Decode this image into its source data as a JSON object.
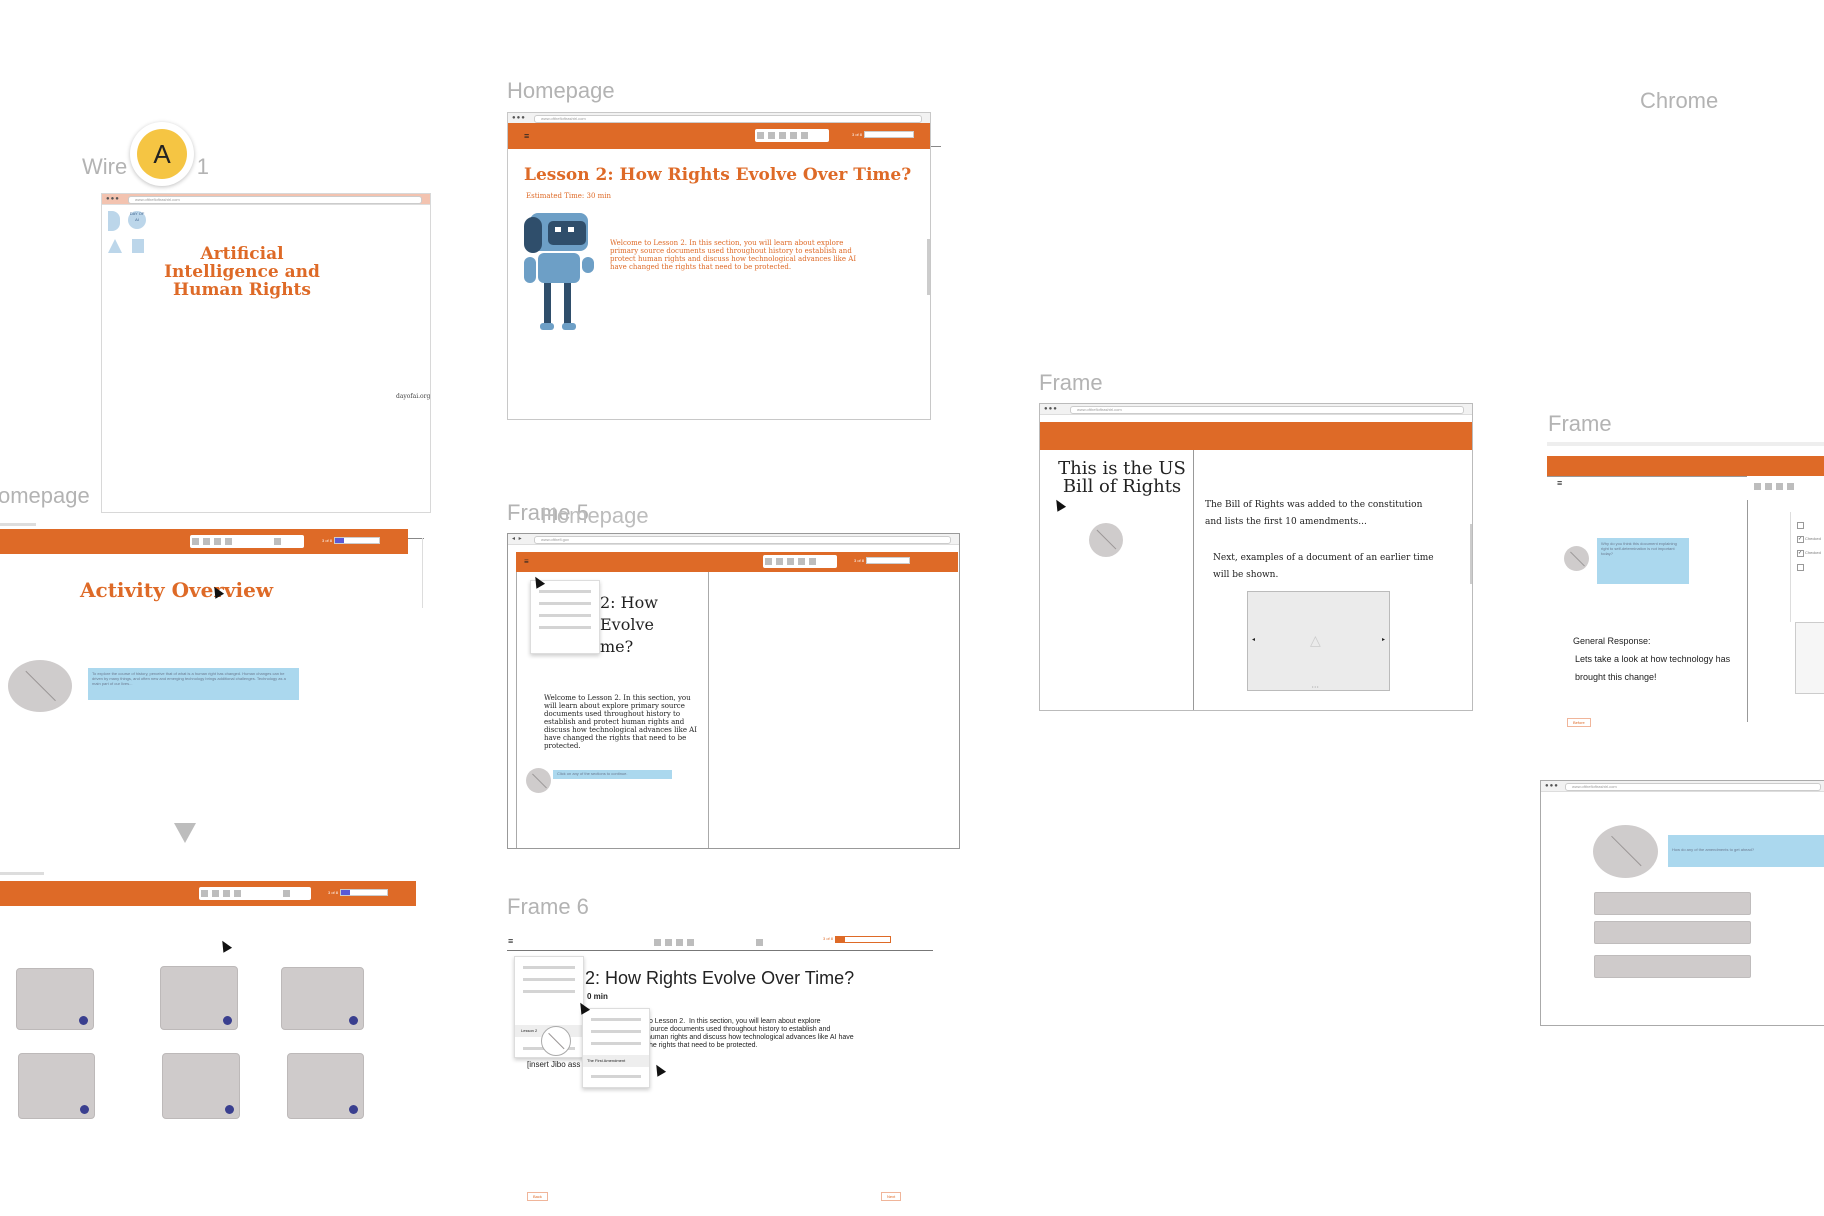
{
  "labels": {
    "wireframe": "Wire",
    "wireframe_suffix": "- 1",
    "homepage_top": "Homepage",
    "homepage_left": "omepage",
    "frame5": "Frame 5",
    "homepage_overlap": "Homepage",
    "frame6": "Frame 6",
    "frame_bill": "Frame",
    "frame_right": "Frame",
    "chrome": "Chrome"
  },
  "avatar_badge": "A",
  "colors": {
    "brand_orange": "#de6a27",
    "bubble_blue": "#abd8ee",
    "slider_fill": "#5b59d6"
  },
  "title_frame": {
    "url": "www.ofthefloftrashtrl.com",
    "heading": "Artificial Intelligence and Human Rights",
    "logo_text": "DAY OF AI",
    "footer_link": "dayofai.org"
  },
  "lesson_frame": {
    "url": "www.ofthefloftrashtrl.com",
    "progress": "3 of 8",
    "title": "Lesson 2: How Rights Evolve Over Time?",
    "estimated": "Estimated Time: 30 min",
    "intro": "Welcome to Lesson 2.  In this section, you will learn about explore primary source documents used throughout history to establish and protect human rights and discuss how technological advances like AI have changed the rights that need to be protected."
  },
  "activity_frame": {
    "progress": "3 of 8",
    "title": "Activity Overview",
    "bubble": "To explore the course of history, perceive that of what is a human right has changed. Human changes can be driven by many things, and often new and emerging technology brings additional challenges. Technology as a main part of our lives..."
  },
  "grid_frame": {
    "progress": "3 of 8"
  },
  "frame5": {
    "url": "www.ofthefl.gov",
    "progress": "3 of 8",
    "title_fragment": "2: How\nEvolve\nme?",
    "intro": "Welcome to Lesson 2.  In this section, you will learn about explore primary source documents used throughout history to establish and protect human rights and discuss how technological advances like AI have changed the rights that need to be protected.",
    "bubble": "Click on any of the sections to continue."
  },
  "frame6": {
    "progress": "3 of 8",
    "title": "2: How Rights Evolve Over Time?",
    "time": "0 min",
    "intro": "to Lesson 2.  In this section, you will learn about explore\nsource documents used throughout history to establish and\nhuman rights and discuss how technological advances like AI have\nthe rights that need to be protected.",
    "placeholder": "[insert Jibo ass",
    "menu_item": "Lesson 2",
    "submenu_item": "The First Amendment",
    "back_label": "Back",
    "next_label": "Next"
  },
  "bill_frame": {
    "url": "www.ofthefloftrashtrl.com",
    "title": "This is the US Bill of Rights",
    "p1": "The Bill of Rights was added to the constitution and lists the first 10 amendments...",
    "p2": "Next, examples of a document of an earlier time will be shown."
  },
  "right_frame": {
    "bubble": "Why do you think this document explaining right to self-determination is not important today?",
    "general_response_label": "General Response:",
    "general_response": "Lets take a look at how technology has brought this change!",
    "checklist": [
      "",
      "Checked",
      "Checked",
      ""
    ],
    "before_label": "Before"
  },
  "right_bottom_frame": {
    "url": "www.ofthefloftrashtrl.com",
    "bubble": "How do any of the amendments to get ahead?"
  }
}
